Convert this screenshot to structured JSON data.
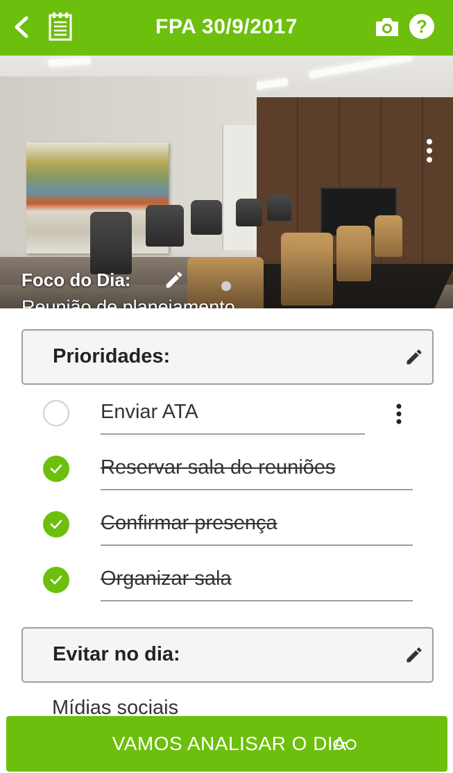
{
  "appbar": {
    "title": "FPA 30/9/2017",
    "background": "#6cbf0c",
    "icons": [
      "back-arrow-icon",
      "notes-icon",
      "camera-icon",
      "help-icon"
    ],
    "help_glyph": "?"
  },
  "hero": {
    "focus_title": "Foco do Dia:",
    "focus_text": "Reunião de planejamento",
    "icons": [
      "edit-pencil-icon",
      "more-vert-icon"
    ]
  },
  "priorities": {
    "label": "Prioridades:",
    "tasks": [
      {
        "text": "Enviar ATA",
        "done": false
      },
      {
        "text": "Reservar sala de reuniões",
        "done": true
      },
      {
        "text": "Confirmar presença",
        "done": true
      },
      {
        "text": "Organizar sala",
        "done": true
      }
    ]
  },
  "avoid": {
    "label": "Evitar no dia:",
    "items": [
      "Mídias sociais"
    ]
  },
  "bottom_button": {
    "label": "VAMOS ANALISAR O DIA",
    "icon": "glasses-icon"
  }
}
